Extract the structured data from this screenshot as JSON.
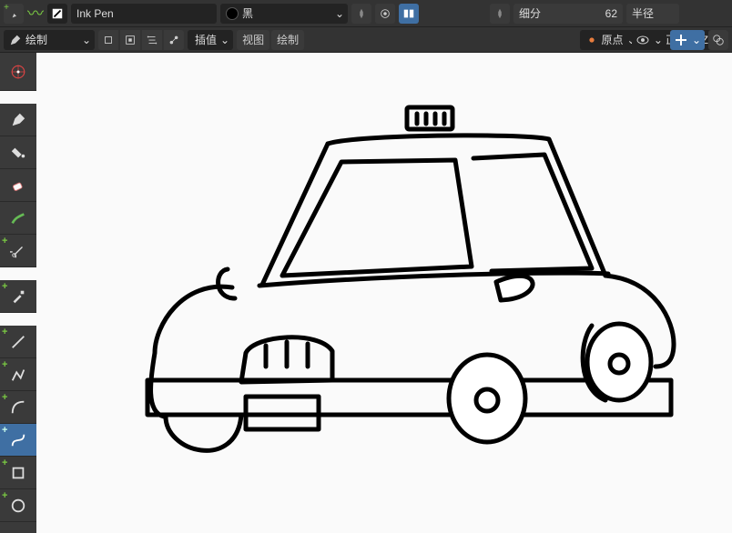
{
  "header": {
    "brush_name": "Ink Pen",
    "material_label": "黑",
    "subdiv_label": "细分",
    "subdiv_value": "62",
    "radius_label": "半径"
  },
  "toolbar2": {
    "mode_label": "绘制",
    "interp_label": "插值",
    "view_label": "视图",
    "draw_label": "绘制",
    "origin_label": "原点",
    "plane_label": "正面(X-Z)"
  },
  "tools": [
    {
      "name": "cursor",
      "active": false
    },
    {
      "name": "draw",
      "active": false
    },
    {
      "name": "fill",
      "active": false
    },
    {
      "name": "erase",
      "active": false
    },
    {
      "name": "tint",
      "active": false
    },
    {
      "name": "cutter",
      "active": false
    },
    {
      "name": "eyedropper",
      "active": false
    },
    {
      "name": "line",
      "active": false
    },
    {
      "name": "polyline",
      "active": false
    },
    {
      "name": "arc",
      "active": false
    },
    {
      "name": "curve",
      "active": true
    },
    {
      "name": "box",
      "active": false
    },
    {
      "name": "circle",
      "active": false
    }
  ]
}
